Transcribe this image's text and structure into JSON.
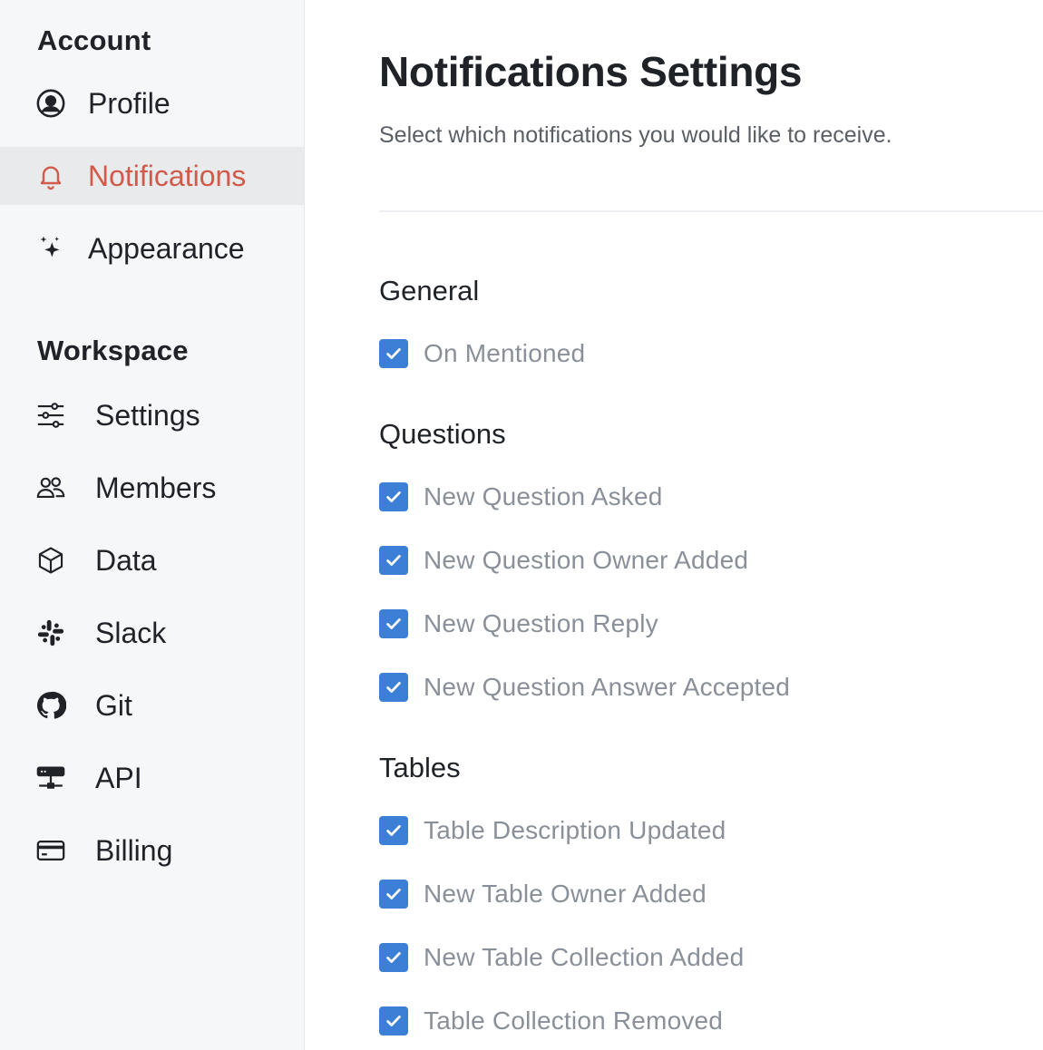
{
  "sidebar": {
    "account_title": "Account",
    "account_items": [
      {
        "label": "Profile",
        "icon": "user-circle-icon"
      },
      {
        "label": "Notifications",
        "icon": "bell-icon",
        "active": true
      },
      {
        "label": "Appearance",
        "icon": "sparkles-icon"
      }
    ],
    "workspace_title": "Workspace",
    "workspace_items": [
      {
        "label": "Settings",
        "icon": "sliders-icon"
      },
      {
        "label": "Members",
        "icon": "users-icon"
      },
      {
        "label": "Data",
        "icon": "cube-icon"
      },
      {
        "label": "Slack",
        "icon": "slack-icon"
      },
      {
        "label": "Git",
        "icon": "github-icon"
      },
      {
        "label": "API",
        "icon": "api-icon"
      },
      {
        "label": "Billing",
        "icon": "credit-card-icon"
      }
    ]
  },
  "main": {
    "title": "Notifications Settings",
    "subtitle": "Select which notifications you would like to receive.",
    "groups": [
      {
        "title": "General",
        "options": [
          {
            "label": "On Mentioned",
            "checked": true
          }
        ]
      },
      {
        "title": "Questions",
        "options": [
          {
            "label": "New Question Asked",
            "checked": true
          },
          {
            "label": "New Question Owner Added",
            "checked": true
          },
          {
            "label": "New Question Reply",
            "checked": true
          },
          {
            "label": "New Question Answer Accepted",
            "checked": true
          }
        ]
      },
      {
        "title": "Tables",
        "options": [
          {
            "label": "Table Description Updated",
            "checked": true
          },
          {
            "label": "New Table Owner Added",
            "checked": true
          },
          {
            "label": "New Table Collection Added",
            "checked": true
          },
          {
            "label": "Table Collection Removed",
            "checked": true
          }
        ]
      }
    ]
  },
  "colors": {
    "accent_active": "#d15a4a",
    "checkbox": "#3b7fd6",
    "sidebar_bg": "#f6f7f9",
    "active_bg": "#e9eaec"
  }
}
